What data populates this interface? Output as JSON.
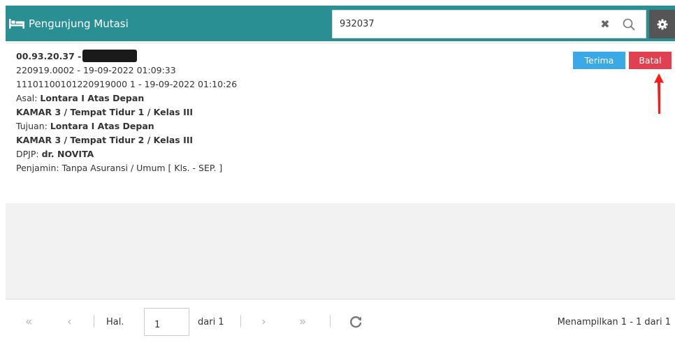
{
  "header": {
    "title": "Pengunjung Mutasi",
    "icon": "bed-icon"
  },
  "search": {
    "value": "932037",
    "clear_icon": "close-icon",
    "search_icon": "search-icon",
    "settings_icon": "gear-icon"
  },
  "record": {
    "id": "00.93.20.37 -",
    "line2": "220919.0002 - 19-09-2022 01:09:33",
    "line3": "11101100101220919000 1 - 19-09-2022 01:10:26",
    "asal_label": "Asal: ",
    "asal_value": "Lontara I Atas Depan",
    "asal_room": "KAMAR 3 / Tempat Tidur 1 / Kelas III",
    "tujuan_label": "Tujuan: ",
    "tujuan_value": "Lontara I Atas Depan",
    "tujuan_room": "KAMAR 3 / Tempat Tidur 2 / Kelas III",
    "dpjp_label": "DPJP: ",
    "dpjp_value": "dr. NOVITA",
    "penjamin": "Penjamin: Tanpa Asuransi / Umum [ Kls. - SEP. ]",
    "accept_label": "Terima",
    "cancel_label": "Batal"
  },
  "pager": {
    "page_label": "Hal.",
    "page_value": "1",
    "of_label": "dari 1",
    "summary": "Menampilkan 1 - 1 dari 1"
  },
  "colors": {
    "header": "#2a8f92",
    "accept": "#3aa9e6",
    "cancel": "#e0404f",
    "annotation": "#ff0000"
  }
}
